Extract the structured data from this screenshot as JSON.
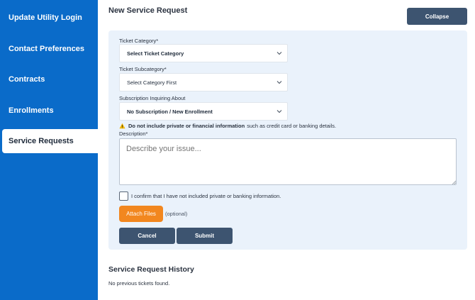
{
  "sidebar": {
    "items": [
      {
        "label": "Update Utility Login",
        "active": false
      },
      {
        "label": "Contact Preferences",
        "active": false
      },
      {
        "label": "Contracts",
        "active": false
      },
      {
        "label": "Enrollments",
        "active": false
      },
      {
        "label": "Service Requests",
        "active": true
      }
    ]
  },
  "main": {
    "title": "New Service Request",
    "collapse_label": "Collapse"
  },
  "form": {
    "category": {
      "label": "Ticket Category*",
      "value": "Select Ticket Category"
    },
    "subcategory": {
      "label": "Ticket Subcategory*",
      "value": "Select Category First"
    },
    "subscription": {
      "label": "Subscription Inquiring About",
      "value": "No Subscription / New Enrollment"
    },
    "warning": {
      "bold": "Do not include private or financial information",
      "rest": "such as credit card or banking details."
    },
    "description": {
      "label": "Description*",
      "placeholder": "Describe your issue..."
    },
    "confirm_text": "I confirm that I have not included private or banking information.",
    "confirm_checked": false,
    "attach_label": "Attach Files",
    "attach_optional": "(optional)",
    "cancel_label": "Cancel",
    "submit_label": "Submit"
  },
  "history": {
    "title": "Service Request History",
    "empty_text": "No previous tickets found."
  },
  "colors": {
    "sidebar_bg": "#0a6bc9",
    "button_dark": "#3d5470",
    "attach_orange": "#f2871f",
    "card_bg": "#eaf2fb",
    "warning_yellow": "#f2b705"
  },
  "icons": {
    "select_chevron": "chevron-down-icon",
    "warning": "warning-icon"
  }
}
